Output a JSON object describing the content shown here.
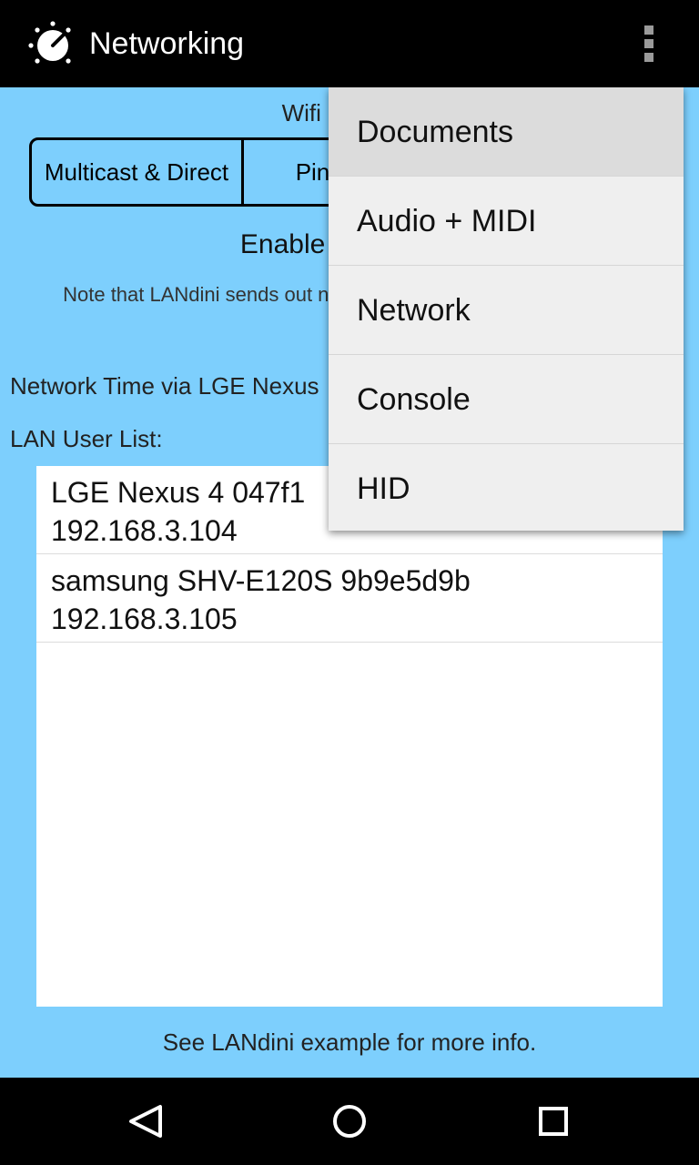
{
  "appbar": {
    "title": "Networking",
    "app_icon": "dial-knob-icon",
    "overflow_icon": "more-vertical-icon"
  },
  "content": {
    "wifi_label": "Wifi network:",
    "segments": [
      {
        "label": "Multicast & Direct"
      },
      {
        "label": "Ping &"
      }
    ],
    "enable_label": "Enable LANdini (v",
    "note": "Note that LANdini sends out n company networks may not li best",
    "network_time": "Network Time via LGE Nexus",
    "lan_user_list_label": "LAN User List:",
    "users": [
      {
        "name": "LGE Nexus 4 047f1",
        "ip": "192.168.3.104"
      },
      {
        "name": "samsung SHV-E120S 9b9e5d9b",
        "ip": "192.168.3.105"
      }
    ],
    "footer": "See LANdini example for more info."
  },
  "menu": {
    "items": [
      {
        "label": "Documents"
      },
      {
        "label": "Audio + MIDI"
      },
      {
        "label": "Network"
      },
      {
        "label": "Console"
      },
      {
        "label": "HID"
      }
    ]
  },
  "navbar": {
    "back_icon": "back-triangle-icon",
    "home_icon": "home-circle-icon",
    "recents_icon": "recents-square-icon"
  },
  "colors": {
    "background": "#7dcffd",
    "appbar": "#000000",
    "menu": "#efefef"
  }
}
